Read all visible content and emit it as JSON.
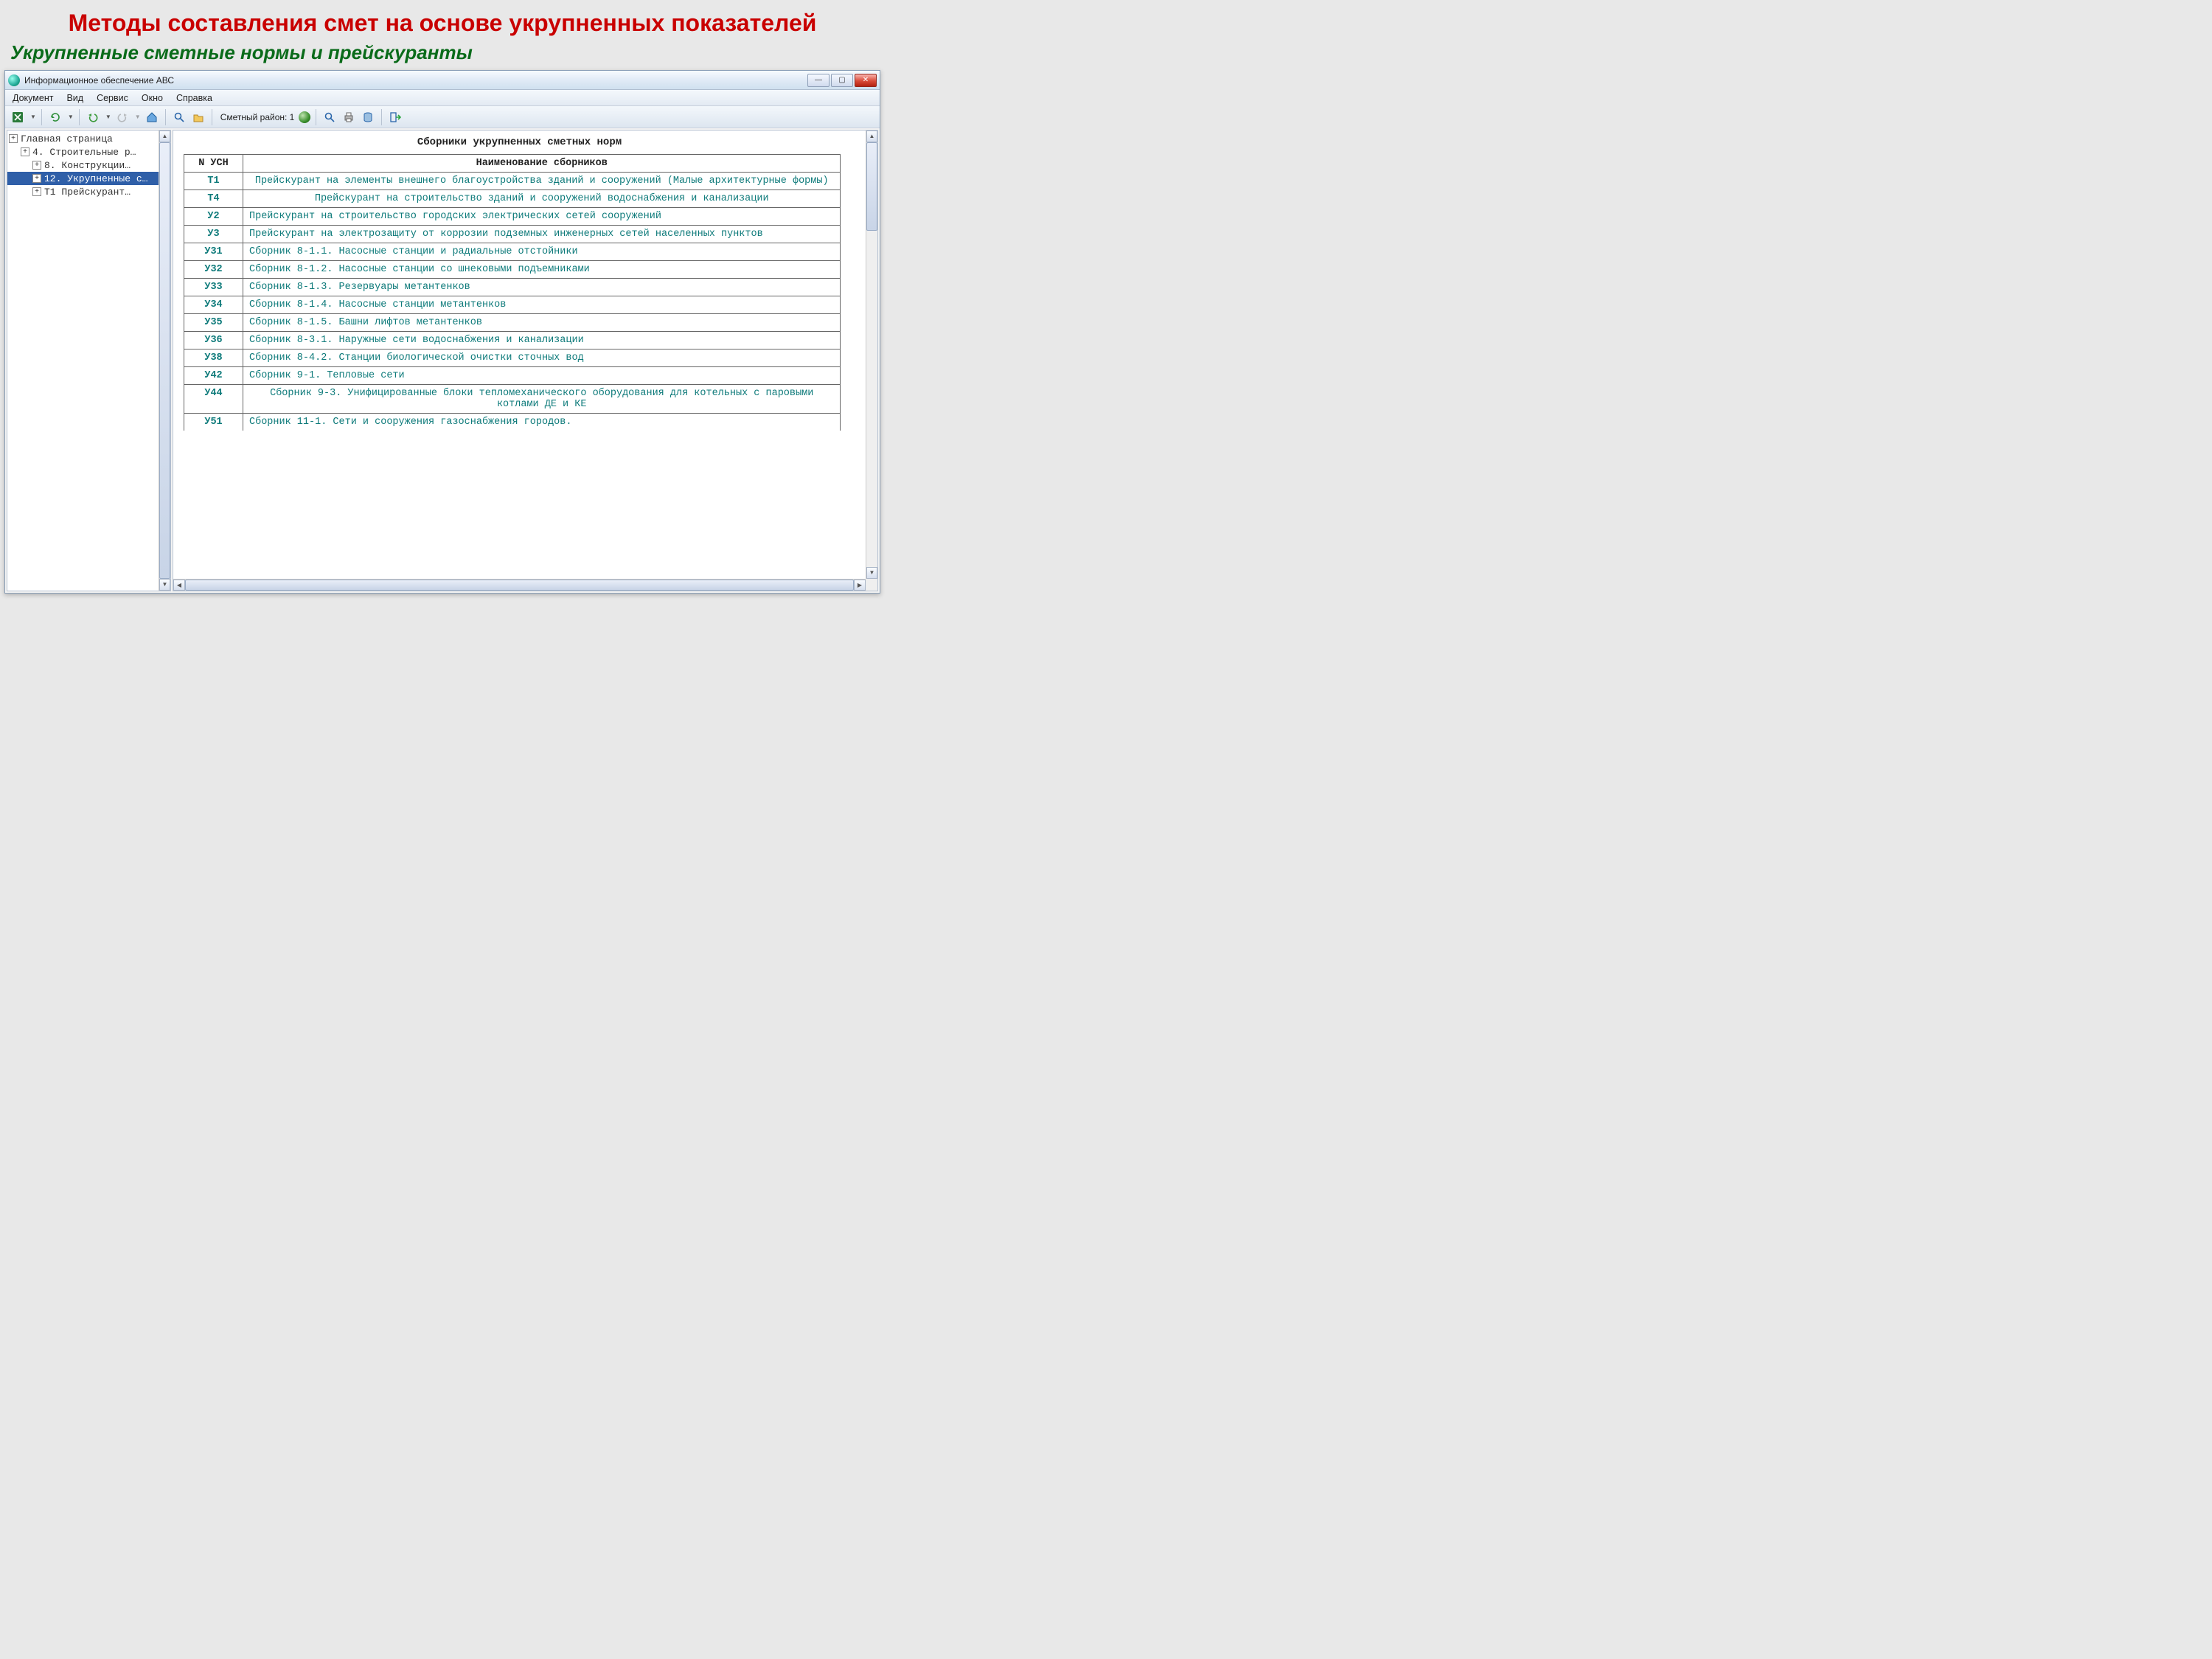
{
  "slide": {
    "title": "Методы составления смет на основе укрупненных показателей",
    "subtitle": "Укрупненные сметные нормы и прейскуранты"
  },
  "app": {
    "title": "Информационное обеспечение АВС",
    "menus": [
      "Документ",
      "Вид",
      "Сервис",
      "Окно",
      "Справка"
    ],
    "region_label": "Сметный район: 1"
  },
  "tree": {
    "root": "Главная страница",
    "items": [
      {
        "indent": 1,
        "label": "4. Строительные р…",
        "selected": false
      },
      {
        "indent": 2,
        "label": "8. Конструкции…",
        "selected": false
      },
      {
        "indent": 2,
        "label": "12. Укрупненные с…",
        "selected": true
      },
      {
        "indent": 2,
        "label": "Т1 Прейскурант…",
        "selected": false
      }
    ]
  },
  "main": {
    "heading": "Сборники укрупненных сметных норм",
    "columns": [
      "N УСН",
      "Наименование сборников"
    ],
    "rows": [
      {
        "code": "Т1",
        "name": "Прейскурант на элементы внешнего благоустройства зданий и сооружений (Малые архитектурные формы)",
        "center": true
      },
      {
        "code": "Т4",
        "name": "Прейскурант на строительство зданий и сооружений водоснабжения и канализации",
        "center": true
      },
      {
        "code": "У2",
        "name": "Прейскурант на строительство городских электрических сетей сооружений"
      },
      {
        "code": "У3",
        "name": "Прейскурант на электрозащиту от коррозии подземных инженерных сетей населенных пунктов"
      },
      {
        "code": "У31",
        "name": "Сборник 8-1.1. Насосные станции и радиальные отстойники"
      },
      {
        "code": "У32",
        "name": "Сборник 8-1.2. Насосные станции со шнековыми подъемниками"
      },
      {
        "code": "У33",
        "name": "Сборник 8-1.3. Резервуары метантенков"
      },
      {
        "code": "У34",
        "name": "Сборник 8-1.4. Насосные станции метантенков"
      },
      {
        "code": "У35",
        "name": "Сборник 8-1.5. Башни лифтов метантенков"
      },
      {
        "code": "У36",
        "name": "Сборник 8-3.1. Наружные сети водоснабжения и канализации"
      },
      {
        "code": "У38",
        "name": "Сборник 8-4.2. Станции биологической очистки сточных вод"
      },
      {
        "code": "У42",
        "name": "Сборник 9-1. Тепловые сети"
      },
      {
        "code": "У44",
        "name": "Сборник 9-3. Унифицированные блоки тепломеханического оборудования для котельных с паровыми котлами ДЕ и КЕ",
        "center": true
      },
      {
        "code": "У51",
        "name": "Сборник 11-1. Сети и сооружения газоснабжения городов.",
        "cut": true
      }
    ]
  }
}
